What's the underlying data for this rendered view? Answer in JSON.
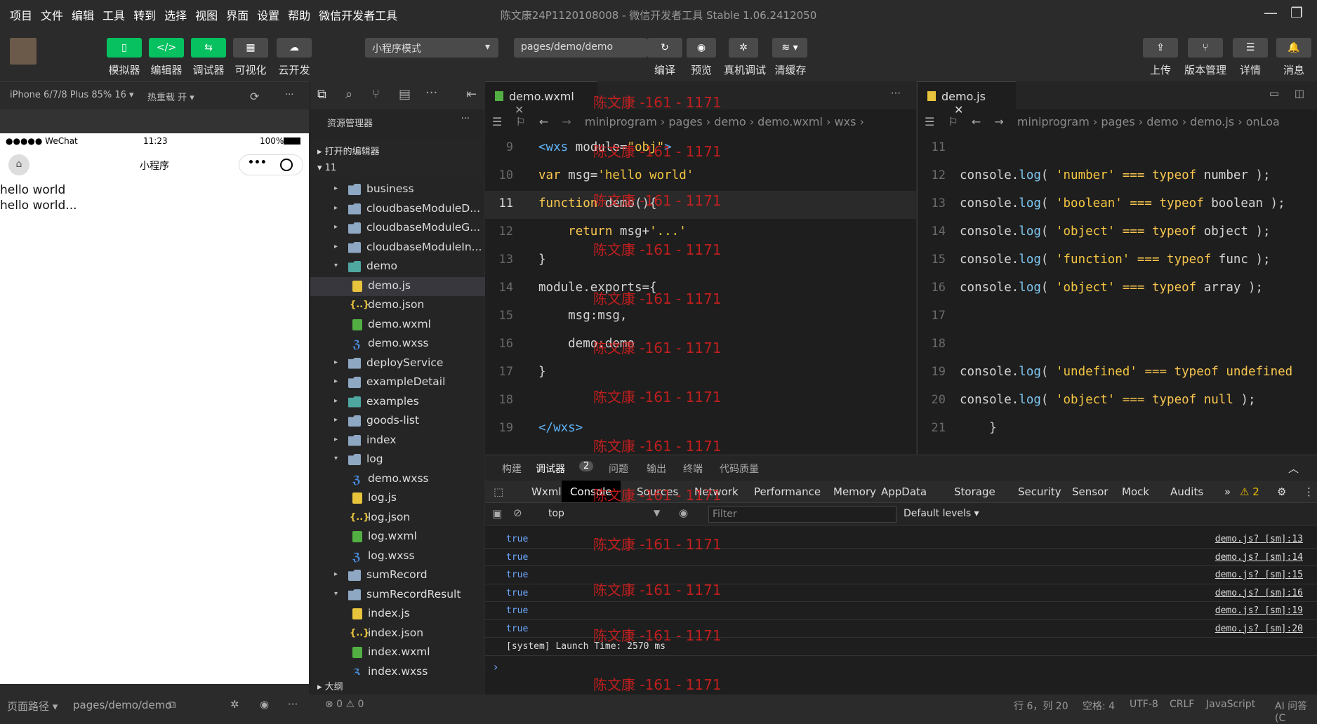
{
  "menu": [
    "项目",
    "文件",
    "编辑",
    "工具",
    "转到",
    "选择",
    "视图",
    "界面",
    "设置",
    "帮助",
    "微信开发者工具"
  ],
  "window_title": "陈文康24P1120108008 - 微信开发者工具 Stable 1.06.2412050",
  "toolbar": {
    "simulator": "模拟器",
    "editor": "编辑器",
    "debugger": "调试器",
    "visual": "可视化",
    "cloud": "云开发",
    "mode": "小程序模式",
    "path": "pages/demo/demo",
    "compile": "编译",
    "preview": "预览",
    "realdebug": "真机调试",
    "clearcache": "清缓存",
    "upload": "上传",
    "version": "版本管理",
    "details": "详情",
    "messages": "消息"
  },
  "sim": {
    "device": "iPhone 6/7/8 Plus 85% 16 ▾",
    "hotreload": "热重载 开 ▾",
    "carrier": "●●●●● WeChat",
    "time": "11:23",
    "battery": "100%",
    "nav_title": "小程序",
    "line1": "hello world",
    "line2": "hello world...",
    "footer_label": "页面路径 ▾",
    "footer_path": "pages/demo/demo"
  },
  "explorer": {
    "title": "资源管理器",
    "open_editors": "打开的编辑器",
    "project": "11",
    "outline": "大纲",
    "tree": [
      {
        "label": "business",
        "type": "folder",
        "depth": 0,
        "caret": "▸"
      },
      {
        "label": "cloudbaseModuleD...",
        "type": "folder",
        "depth": 0,
        "caret": "▸"
      },
      {
        "label": "cloudbaseModuleG...",
        "type": "folder",
        "depth": 0,
        "caret": "▸"
      },
      {
        "label": "cloudbaseModuleIn...",
        "type": "folder",
        "depth": 0,
        "caret": "▸"
      },
      {
        "label": "demo",
        "type": "folderg",
        "depth": 0,
        "caret": "▾"
      },
      {
        "label": "demo.js",
        "type": "js",
        "depth": 1,
        "sel": true
      },
      {
        "label": "demo.json",
        "type": "json",
        "depth": 1
      },
      {
        "label": "demo.wxml",
        "type": "wxml",
        "depth": 1
      },
      {
        "label": "demo.wxss",
        "type": "wxss",
        "depth": 1
      },
      {
        "label": "deployService",
        "type": "folder",
        "depth": 0,
        "caret": "▸"
      },
      {
        "label": "exampleDetail",
        "type": "folder",
        "depth": 0,
        "caret": "▸"
      },
      {
        "label": "examples",
        "type": "folderg",
        "depth": 0,
        "caret": "▸"
      },
      {
        "label": "goods-list",
        "type": "folder",
        "depth": 0,
        "caret": "▸"
      },
      {
        "label": "index",
        "type": "folder",
        "depth": 0,
        "caret": "▸"
      },
      {
        "label": "log",
        "type": "folder",
        "depth": 0,
        "caret": "▾"
      },
      {
        "label": "demo.wxss",
        "type": "wxss",
        "depth": 1
      },
      {
        "label": "log.js",
        "type": "js",
        "depth": 1
      },
      {
        "label": "log.json",
        "type": "json",
        "depth": 1
      },
      {
        "label": "log.wxml",
        "type": "wxml",
        "depth": 1
      },
      {
        "label": "log.wxss",
        "type": "wxss",
        "depth": 1
      },
      {
        "label": "sumRecord",
        "type": "folder",
        "depth": 0,
        "caret": "▸"
      },
      {
        "label": "sumRecordResult",
        "type": "folder",
        "depth": 0,
        "caret": "▾"
      },
      {
        "label": "index.js",
        "type": "js",
        "depth": 1
      },
      {
        "label": "index.json",
        "type": "json",
        "depth": 1
      },
      {
        "label": "index.wxml",
        "type": "wxml",
        "depth": 1
      },
      {
        "label": "index.wxss",
        "type": "wxss",
        "depth": 1
      }
    ]
  },
  "editor1": {
    "tab": "demo.wxml",
    "crumb": "miniprogram › pages › demo › demo.wxml › wxs ›",
    "lines": [
      {
        "n": "9",
        "html": "<span class='tag'>&lt;wxs</span> module=<span class='str'>\"obj\"</span><span class='tag'>&gt;</span>"
      },
      {
        "n": "10",
        "html": "<span class='kw'>var</span> msg=<span class='str'>'hello world'</span>"
      },
      {
        "n": "11",
        "html": "<span class='kw'>function</span> demo(){"
      },
      {
        "n": "12",
        "html": "    <span class='kw'>return</span> msg+<span class='str'>'...'</span>"
      },
      {
        "n": "13",
        "html": "}"
      },
      {
        "n": "14",
        "html": "module.exports={"
      },
      {
        "n": "15",
        "html": "    msg:msg,"
      },
      {
        "n": "16",
        "html": "    demo:demo"
      },
      {
        "n": "17",
        "html": "}"
      },
      {
        "n": "18",
        "html": ""
      },
      {
        "n": "19",
        "html": "<span class='tag'>&lt;/wxs&gt;</span>"
      }
    ]
  },
  "editor2": {
    "tab": "demo.js",
    "crumb": "miniprogram › pages › demo › demo.js › onLoa",
    "lines": [
      {
        "n": "11",
        "html": ""
      },
      {
        "n": "12",
        "html": "console.<span class='fn'>log</span>( <span class='str'>'number'</span> <span class='kw'>===</span> <span class='kw'>typeof</span> number );"
      },
      {
        "n": "13",
        "html": "console.<span class='fn'>log</span>( <span class='str'>'boolean'</span> <span class='kw'>===</span> <span class='kw'>typeof</span> boolean );"
      },
      {
        "n": "14",
        "html": "console.<span class='fn'>log</span>( <span class='str'>'object'</span> <span class='kw'>===</span> <span class='kw'>typeof</span> object );"
      },
      {
        "n": "15",
        "html": "console.<span class='fn'>log</span>( <span class='str'>'function'</span> <span class='kw'>===</span> <span class='kw'>typeof</span> func );"
      },
      {
        "n": "16",
        "html": "console.<span class='fn'>log</span>( <span class='str'>'object'</span> <span class='kw'>===</span> <span class='kw'>typeof</span> array );"
      },
      {
        "n": "17",
        "html": ""
      },
      {
        "n": "18",
        "html": ""
      },
      {
        "n": "19",
        "html": "console.<span class='fn'>log</span>( <span class='str'>'undefined'</span> <span class='kw'>===</span> <span class='kw'>typeof</span> <span class='kw'>undefined</span>"
      },
      {
        "n": "20",
        "html": "console.<span class='fn'>log</span>( <span class='str'>'object'</span> <span class='kw'>===</span> <span class='kw'>typeof</span> <span class='kw'>null</span> );"
      },
      {
        "n": "21",
        "html": "    }"
      }
    ]
  },
  "panel": {
    "tabs": [
      "构建",
      "调试器",
      "问题",
      "输出",
      "终端",
      "代码质量"
    ],
    "badge": "2",
    "devtabs": [
      "Wxml",
      "Console",
      "Sources",
      "Network",
      "Performance",
      "Memory",
      "AppData",
      "Storage",
      "Security",
      "Sensor",
      "Mock",
      "Audits"
    ],
    "more": "»",
    "warn": "⚠ 2",
    "context": "top",
    "filter": "Filter",
    "levels": "Default levels ▾",
    "logs": [
      {
        "v": "true",
        "s": "demo.js? [sm]:13"
      },
      {
        "v": "true",
        "s": "demo.js? [sm]:14"
      },
      {
        "v": "true",
        "s": "demo.js? [sm]:15"
      },
      {
        "v": "true",
        "s": "demo.js? [sm]:16"
      },
      {
        "v": "true",
        "s": "demo.js? [sm]:19"
      },
      {
        "v": "true",
        "s": "demo.js? [sm]:20"
      }
    ],
    "system": "[system] Launch Time: 2570 ms",
    "prompt": "›"
  },
  "status": {
    "errors": "⊗ 0 ⚠ 0",
    "pos": "行 6，列 20",
    "spaces": "空格: 4",
    "enc": "UTF-8",
    "eol": "CRLF",
    "lang": "JavaScript",
    "ai": "AI 问答 (C"
  },
  "watermark": "陈文康 -161 - 1171"
}
